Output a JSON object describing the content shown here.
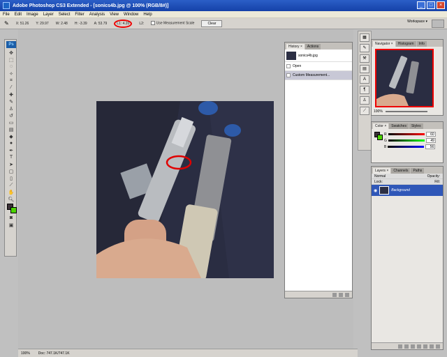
{
  "window": {
    "title": "Adobe Photoshop CS3 Extended - [sonics4b.jpg @ 100% (RGB/8#)]",
    "min": "_",
    "max": "□",
    "close": "×"
  },
  "menu": [
    "File",
    "Edit",
    "Image",
    "Layer",
    "Select",
    "Filter",
    "Analysis",
    "View",
    "Window",
    "Help"
  ],
  "options": {
    "x": "X: 51.26",
    "y": "Y: 29.97",
    "w": "W: 2.48",
    "h": "H: -3.39",
    "a": "A: 53.79",
    "l1": "L1: 4.20",
    "l2": "L2:",
    "use_scale": "Use Measurement Scale",
    "clear": "Clear"
  },
  "workspace": "Workspace ▾",
  "status": {
    "zoom": "100%",
    "doc": "Doc: 747.1K/747.1K"
  },
  "history": {
    "tabs": [
      "History ×",
      "Actions"
    ],
    "snapshot": "sonics4b.jpg",
    "steps": [
      "Open",
      "Custom Measurement..."
    ]
  },
  "navigator": {
    "tabs": [
      "Navigator ×",
      "Histogram",
      "Info"
    ],
    "zoom": "100%"
  },
  "color": {
    "tabs": [
      "Color ×",
      "Swatches",
      "Styles"
    ],
    "r": "60",
    "g": "49",
    "b": "56",
    "r_label": "R",
    "g_label": "G",
    "b_label": "B"
  },
  "layers": {
    "tabs": [
      "Layers ×",
      "Channels",
      "Paths"
    ],
    "mode": "Normal",
    "opacity": "Opacity:",
    "lock": "Lock:",
    "fill": "Fill:",
    "layer_name": "Background"
  },
  "colors": {
    "accent": "#2f57b8",
    "highlight": "#e00000"
  }
}
